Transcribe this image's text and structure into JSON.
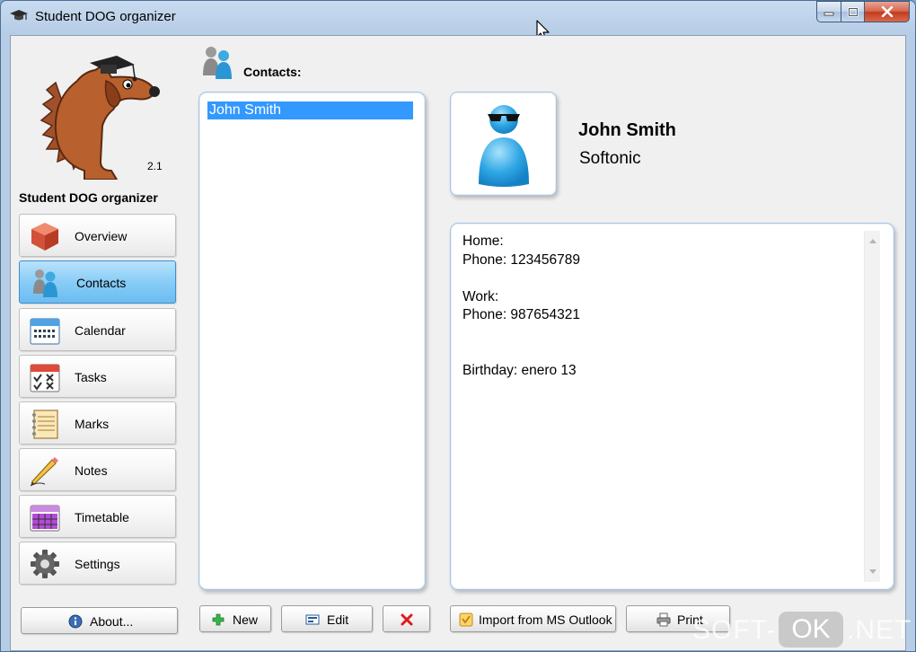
{
  "window": {
    "title": "Student DOG organizer"
  },
  "app": {
    "name": "Student DOG organizer",
    "version": "2.1"
  },
  "nav": {
    "items": [
      {
        "label": "Overview"
      },
      {
        "label": "Contacts"
      },
      {
        "label": "Calendar"
      },
      {
        "label": "Tasks"
      },
      {
        "label": "Marks"
      },
      {
        "label": "Notes"
      },
      {
        "label": "Timetable"
      },
      {
        "label": "Settings"
      }
    ],
    "active": "Contacts",
    "about_label": "About..."
  },
  "contacts": {
    "header": "Contacts:",
    "list": [
      "John Smith"
    ],
    "selected": {
      "name": "John Smith",
      "company": "Softonic",
      "details": "Home:\nPhone: 123456789\n\nWork:\nPhone: 987654321\n\n\nBirthday: enero 13"
    }
  },
  "toolbar": {
    "new_label": "New",
    "edit_label": "Edit",
    "import_label": "Import from MS Outlook",
    "print_label": "Print"
  },
  "watermark": {
    "soft": "SOFT-",
    "ok": "OK",
    "net": ".NET"
  },
  "colors": {
    "selection": "#3399ff",
    "active_nav": "#88cdf7",
    "title_bar": "#c8dbef",
    "close_button": "#c23b1f"
  }
}
